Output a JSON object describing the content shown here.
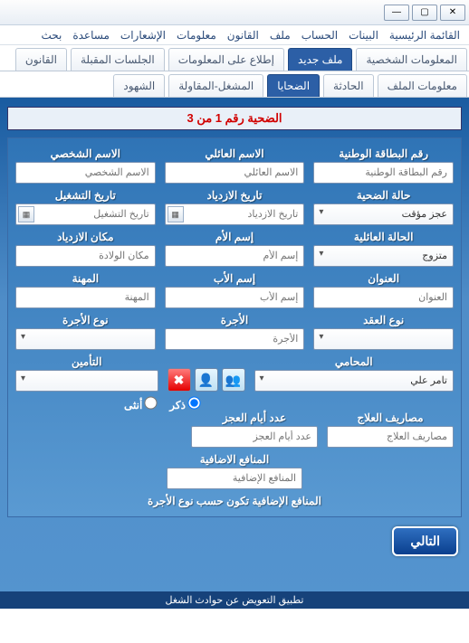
{
  "menu": [
    "القائمة الرئيسية",
    "البينات",
    "الحساب",
    "ملف",
    "القانون",
    "معلومات",
    "الإشعارات",
    "مساعدة",
    "بحث"
  ],
  "tabs1": {
    "items": [
      "المعلومات الشخصية",
      "ملف جديد",
      "إطلاع على المعلومات",
      "الجلسات المقبلة",
      "القانون"
    ],
    "active": 1
  },
  "tabs2": {
    "items": [
      "معلومات الملف",
      "الحادثة",
      "الضحايا",
      "المشغل-المقاولة",
      "الشهود"
    ],
    "active": 2
  },
  "heading": "الضحية رقم 1 من  3",
  "labels": {
    "nid": "رقم البطاقة الوطنية",
    "fam": "الاسم العائلي",
    "pers": "الاسم الشخصي",
    "health": "حالة الضحية",
    "bdate": "تاريخ الازدياد",
    "wdate": "تاريخ التشغيل",
    "marital": "الحالة العائلية",
    "mname": "إسم الأم",
    "bplace": "مكان الازدياد",
    "addr": "العنوان",
    "fname": "إسم الأب",
    "job": "المهنة",
    "ctype": "نوع العقد",
    "wage": "الأجرة",
    "wtype": "نوع الأجرة",
    "lawyer": "المحامي",
    "ins": "التأمين",
    "med": "مصاريف العلاج",
    "ddays": "عدد أيام العجز",
    "addben": "المنافع الاضافية"
  },
  "ph": {
    "nid": "رقم البطاقة الوطنية",
    "fam": "الاسم العائلي",
    "pers": "الاسم الشخصي",
    "bdate": "تاريخ الازدياد",
    "wdate": "تاريخ التشغيل",
    "mname": "إسم الأم",
    "bplace": "مكان الولادة",
    "addr": "العنوان",
    "fname": "إسم الأب",
    "job": "المهنة",
    "wage": "الأجرة",
    "med": "مصاريف العلاج",
    "ddays": "عدد أيام العجز",
    "addben": "المنافع الإضافية"
  },
  "selects": {
    "health": "عجز مؤقت",
    "marital": "متزوج",
    "ctype": "",
    "wtype": "",
    "lawyer": "تامر علي",
    "ins": ""
  },
  "radio": {
    "male": "ذكر",
    "female": "أنثى"
  },
  "note": "المنافع الإضافية تكون حسب نوع الأجرة",
  "next": "التالي",
  "footer": "تطبيق التعويض عن حوادث الشغل"
}
